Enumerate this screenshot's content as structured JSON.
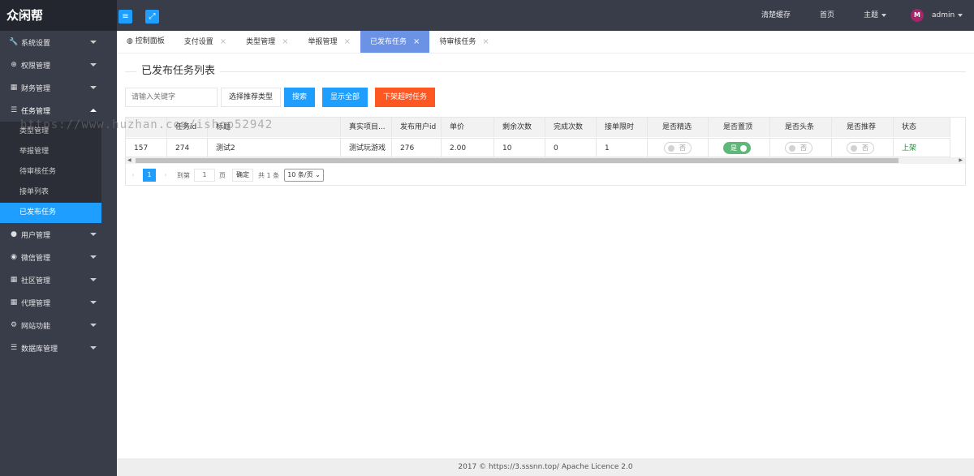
{
  "app": {
    "title": "众闲帮"
  },
  "sidebar": {
    "items": [
      {
        "label": "系统设置",
        "icon": "wrench-icon",
        "glyph": "🔧"
      },
      {
        "label": "权限管理",
        "icon": "globe-icon",
        "glyph": "⊕"
      },
      {
        "label": "财务管理",
        "icon": "table-icon",
        "glyph": "▦"
      },
      {
        "label": "任务管理",
        "icon": "database-icon",
        "glyph": "☰"
      },
      {
        "label": "用户管理",
        "icon": "user-icon",
        "glyph": "●"
      },
      {
        "label": "微信管理",
        "icon": "chat-icon",
        "glyph": "◉"
      },
      {
        "label": "社区管理",
        "icon": "table-icon",
        "glyph": "▦"
      },
      {
        "label": "代理管理",
        "icon": "table-icon",
        "glyph": "▦"
      },
      {
        "label": "网站功能",
        "icon": "gear-icon",
        "glyph": "⚙"
      },
      {
        "label": "数据库管理",
        "icon": "database-icon",
        "glyph": "☰"
      }
    ],
    "task_submenu": [
      "类型管理",
      "举报管理",
      "待审核任务",
      "接单列表",
      "已发布任务"
    ]
  },
  "header": {
    "clear_cache": "清楚缓存",
    "home": "首页",
    "theme": "主题",
    "user": "admin",
    "avatar_letter": "M"
  },
  "tabs": [
    {
      "label": "控制面板"
    },
    {
      "label": "支付设置"
    },
    {
      "label": "类型管理"
    },
    {
      "label": "举报管理"
    },
    {
      "label": "已发布任务"
    },
    {
      "label": "待审核任务"
    }
  ],
  "main": {
    "title": "已发布任务列表",
    "search_placeholder": "请输入关键字",
    "btn_select_type": "选择推荐类型",
    "btn_search": "搜索",
    "btn_show_all": "显示全部",
    "btn_remove_expired": "下架超时任务"
  },
  "table": {
    "columns": [
      "",
      "任务id",
      "标题",
      "真实项目...",
      "发布用户id",
      "单价",
      "剩余次数",
      "完成次数",
      "接单限时",
      "是否精选",
      "是否置顶",
      "是否头条",
      "是否推荐",
      "状态"
    ],
    "rows": [
      {
        "c0": "157",
        "c1": "274",
        "c2": "测试2",
        "c3": "测试玩游戏",
        "c4": "276",
        "c5": "2.00",
        "c6": "10",
        "c7": "0",
        "c8": "1",
        "featured": "否",
        "top": "是",
        "headline": "否",
        "recommend": "否",
        "status": "上架"
      }
    ]
  },
  "pager": {
    "current": "1",
    "goto": "到第",
    "page_input": "1",
    "page_unit": "页",
    "ok": "确定",
    "total": "共 1 条",
    "page_size": "10 条/页"
  },
  "footer": {
    "text": "2017 ©  https://3.sssnn.top/  Apache Licence 2.0"
  },
  "watermark": "https://www.huzhan.com/ishop52942",
  "colors": {
    "sidebar": "#393d49",
    "primary": "#1e9fff",
    "danger": "#ff5722",
    "active_tab": "#6c92e6",
    "toggle_on": "#5fb878"
  }
}
